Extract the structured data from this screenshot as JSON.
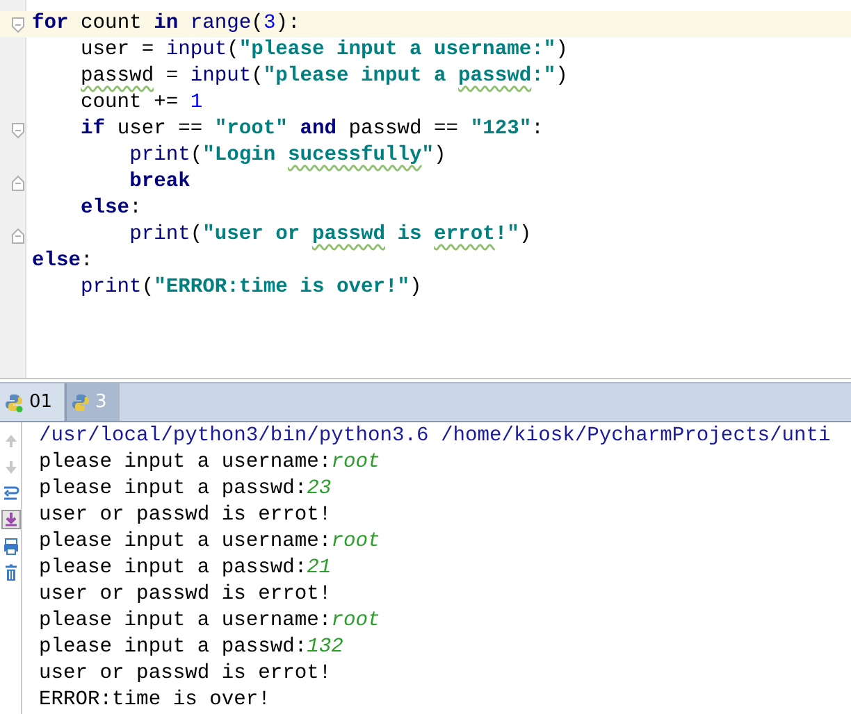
{
  "editor": {
    "lines": [
      {
        "current": true,
        "fold_start": true,
        "fold_end": false,
        "tokens": [
          {
            "kind": "kw",
            "text": "for"
          },
          {
            "kind": "plain",
            "text": " count "
          },
          {
            "kind": "kw",
            "text": "in"
          },
          {
            "kind": "builtin",
            "text": " range"
          },
          {
            "kind": "plain",
            "text": "("
          },
          {
            "kind": "num",
            "text": "3"
          },
          {
            "kind": "plain",
            "text": "):"
          }
        ]
      },
      {
        "current": false,
        "fold_start": false,
        "fold_end": false,
        "tokens": [
          {
            "kind": "plain",
            "text": "    user = "
          },
          {
            "kind": "builtin",
            "text": "input"
          },
          {
            "kind": "plain",
            "text": "("
          },
          {
            "kind": "str",
            "text": "\"please input a username:\""
          },
          {
            "kind": "plain",
            "text": ")"
          }
        ]
      },
      {
        "current": false,
        "fold_start": false,
        "fold_end": false,
        "tokens": [
          {
            "kind": "plain",
            "text": "    passwd",
            "typo": true
          },
          {
            "kind": "plain",
            "text": " = "
          },
          {
            "kind": "builtin",
            "text": "input"
          },
          {
            "kind": "plain",
            "text": "("
          },
          {
            "kind": "str",
            "text": "\"please input a "
          },
          {
            "kind": "str",
            "text": "passwd",
            "typo": true
          },
          {
            "kind": "str",
            "text": ":\""
          },
          {
            "kind": "plain",
            "text": ")"
          }
        ]
      },
      {
        "current": false,
        "fold_start": false,
        "fold_end": false,
        "tokens": [
          {
            "kind": "plain",
            "text": "    count += "
          },
          {
            "kind": "num",
            "text": "1"
          }
        ]
      },
      {
        "current": false,
        "fold_start": true,
        "fold_end": false,
        "tokens": [
          {
            "kind": "kw",
            "text": "    if"
          },
          {
            "kind": "plain",
            "text": " user == "
          },
          {
            "kind": "str",
            "text": "\"root\""
          },
          {
            "kind": "kw",
            "text": " and"
          },
          {
            "kind": "plain",
            "text": " passwd == "
          },
          {
            "kind": "str",
            "text": "\"123\""
          },
          {
            "kind": "plain",
            "text": ":"
          }
        ]
      },
      {
        "current": false,
        "fold_start": false,
        "fold_end": false,
        "tokens": [
          {
            "kind": "builtin",
            "text": "        print"
          },
          {
            "kind": "plain",
            "text": "("
          },
          {
            "kind": "str",
            "text": "\"Login "
          },
          {
            "kind": "str",
            "text": "sucessfully",
            "typo": true
          },
          {
            "kind": "str",
            "text": "\""
          },
          {
            "kind": "plain",
            "text": ")"
          }
        ]
      },
      {
        "current": false,
        "fold_start": false,
        "fold_end": true,
        "tokens": [
          {
            "kind": "kw",
            "text": "        break"
          }
        ]
      },
      {
        "current": false,
        "fold_start": false,
        "fold_end": false,
        "tokens": [
          {
            "kind": "kw",
            "text": "    else"
          },
          {
            "kind": "plain",
            "text": ":"
          }
        ]
      },
      {
        "current": false,
        "fold_start": false,
        "fold_end": true,
        "tokens": [
          {
            "kind": "builtin",
            "text": "        print"
          },
          {
            "kind": "plain",
            "text": "("
          },
          {
            "kind": "str",
            "text": "\"user or "
          },
          {
            "kind": "str",
            "text": "passwd",
            "typo": true
          },
          {
            "kind": "str",
            "text": " is "
          },
          {
            "kind": "str",
            "text": "errot",
            "typo": true
          },
          {
            "kind": "str",
            "text": "!\""
          },
          {
            "kind": "plain",
            "text": ")"
          }
        ]
      },
      {
        "current": false,
        "fold_start": false,
        "fold_end": false,
        "tokens": [
          {
            "kind": "kw",
            "text": "else"
          },
          {
            "kind": "plain",
            "text": ":"
          }
        ]
      },
      {
        "current": false,
        "fold_start": false,
        "fold_end": false,
        "tokens": [
          {
            "kind": "builtin",
            "text": "    print"
          },
          {
            "kind": "plain",
            "text": "("
          },
          {
            "kind": "str",
            "text": "\"ERROR:time is over!\""
          },
          {
            "kind": "plain",
            "text": ")"
          }
        ]
      }
    ]
  },
  "run_tabs": [
    {
      "label": "01",
      "selected": false,
      "running": true
    },
    {
      "label": "3",
      "selected": true,
      "running": false
    }
  ],
  "console": {
    "lines": [
      [
        {
          "kind": "cmd",
          "text": "/usr/local/python3/bin/python3.6 /home/kiosk/PycharmProjects/unti"
        }
      ],
      [
        {
          "kind": "out",
          "text": "please input a username:"
        },
        {
          "kind": "input",
          "text": "root"
        }
      ],
      [
        {
          "kind": "out",
          "text": "please input a passwd:"
        },
        {
          "kind": "input",
          "text": "23"
        }
      ],
      [
        {
          "kind": "out",
          "text": "user or passwd is errot!"
        }
      ],
      [
        {
          "kind": "out",
          "text": "please input a username:"
        },
        {
          "kind": "input",
          "text": "root"
        }
      ],
      [
        {
          "kind": "out",
          "text": "please input a passwd:"
        },
        {
          "kind": "input",
          "text": "21"
        }
      ],
      [
        {
          "kind": "out",
          "text": "user or passwd is errot!"
        }
      ],
      [
        {
          "kind": "out",
          "text": "please input a username:"
        },
        {
          "kind": "input",
          "text": "root"
        }
      ],
      [
        {
          "kind": "out",
          "text": "please input a passwd:"
        },
        {
          "kind": "input",
          "text": "132"
        }
      ],
      [
        {
          "kind": "out",
          "text": "user or passwd is errot!"
        }
      ],
      [
        {
          "kind": "out",
          "text": "ERROR:time is over!"
        }
      ]
    ]
  }
}
